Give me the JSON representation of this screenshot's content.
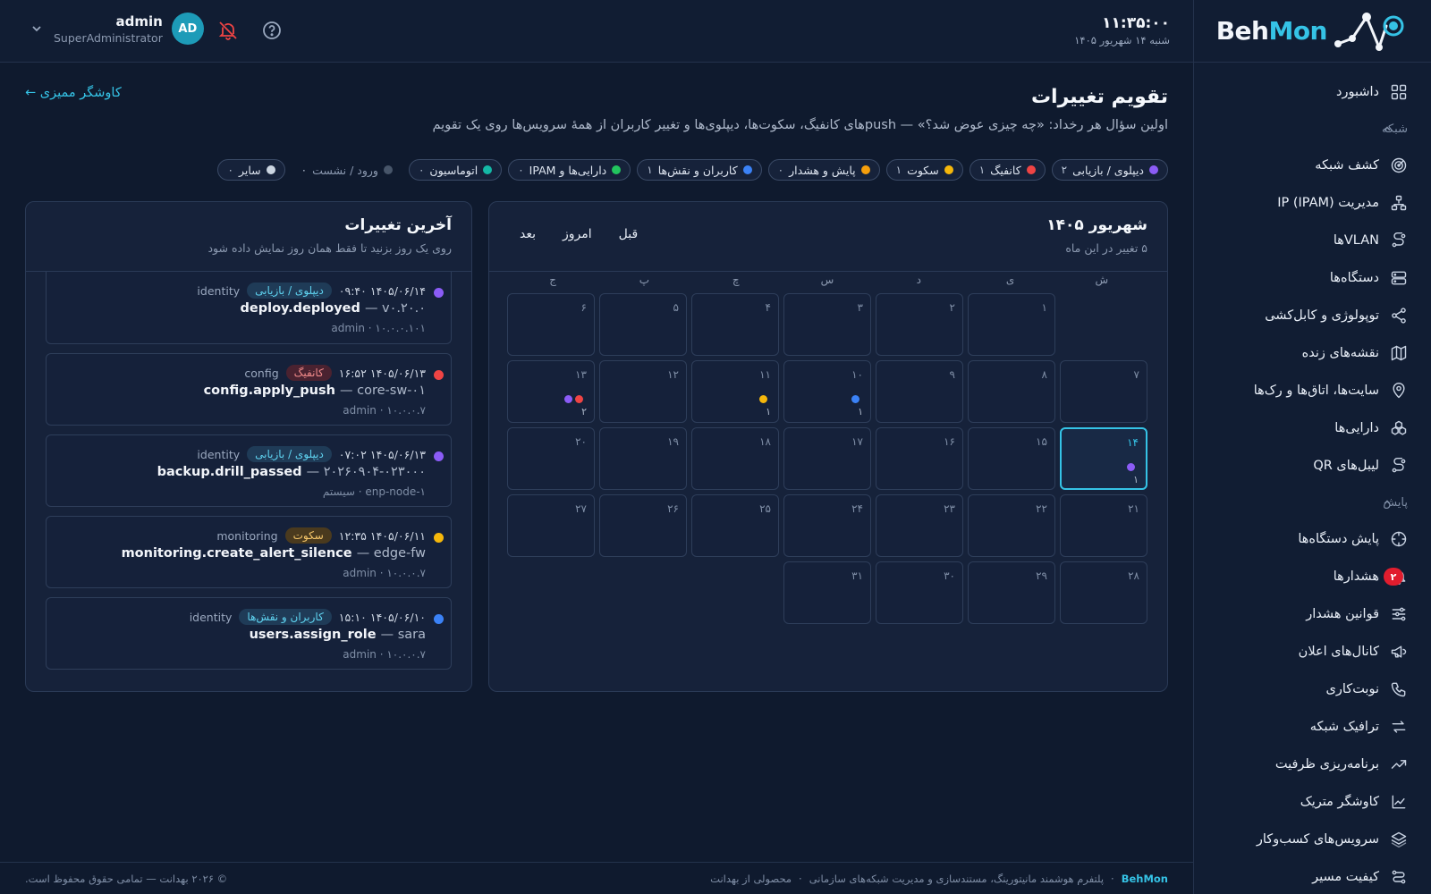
{
  "logo": {
    "part1": "Beh",
    "part2": "Mon"
  },
  "topbar": {
    "time": "۱۱:۳۵:۰۰",
    "date": "شنبه ۱۴ شهریور ۱۴۰۵",
    "user_name": "admin",
    "user_role": "SuperAdministrator",
    "avatar_initials": "AD"
  },
  "sidebar": {
    "items": [
      {
        "label": "داشبورد",
        "icon": "dashboard-icon"
      },
      {
        "section": "شبکه"
      },
      {
        "label": "کشف شبکه",
        "icon": "radar-icon"
      },
      {
        "label": "مدیریت IP (IPAM)",
        "icon": "network-icon"
      },
      {
        "label": "VLANها",
        "icon": "route-icon"
      },
      {
        "label": "دستگاه‌ها",
        "icon": "server-icon"
      },
      {
        "label": "توپولوژی و کابل‌کشی",
        "icon": "share-icon"
      },
      {
        "label": "نقشه‌های زنده",
        "icon": "map-icon"
      },
      {
        "label": "سایت‌ها، اتاق‌ها و رک‌ها",
        "icon": "location-icon"
      },
      {
        "label": "دارایی‌ها",
        "icon": "boxes-icon"
      },
      {
        "label": "لیبل‌های QR",
        "icon": "route-icon"
      },
      {
        "section": "پایش"
      },
      {
        "label": "پایش دستگاه‌ها",
        "icon": "crosshair-icon"
      },
      {
        "label": "هشدارها",
        "icon": "bell-icon",
        "badge": "۲"
      },
      {
        "label": "قوانین هشدار",
        "icon": "sliders-icon"
      },
      {
        "label": "کانال‌های اعلان",
        "icon": "megaphone-icon"
      },
      {
        "label": "نوبت‌کاری",
        "icon": "phone-icon"
      },
      {
        "label": "ترافیک شبکه",
        "icon": "arrows-icon"
      },
      {
        "label": "برنامه‌ریزی ظرفیت",
        "icon": "trend-icon"
      },
      {
        "label": "کاوشگر متریک",
        "icon": "chart-icon"
      },
      {
        "label": "سرویس‌های کسب‌وکار",
        "icon": "layers-icon"
      },
      {
        "label": "کیفیت مسیر",
        "icon": "path-icon"
      }
    ]
  },
  "page": {
    "title": "تقویم تغییرات",
    "subtitle": "اولین سؤال هر رخداد: «چه چیزی عوض شد؟» — pushهای کانفیگ، سکوت‌ها، دیپلوی‌ها و تغییر کاربران از همهٔ سرویس‌ها روی یک تقویم",
    "explorer_link": "کاوشگر ممیزی ←"
  },
  "filters": [
    {
      "label": "دیپلوی / بازیابی",
      "count": "۲",
      "color": "#8b5cf6",
      "plain": false
    },
    {
      "label": "کانفیگ",
      "count": "۱",
      "color": "#ef4444",
      "plain": false
    },
    {
      "label": "سکوت",
      "count": "۱",
      "color": "#f5b70b",
      "plain": false
    },
    {
      "label": "پایش و هشدار",
      "count": "۰",
      "color": "#f59e0b",
      "plain": false
    },
    {
      "label": "کاربران و نقش‌ها",
      "count": "۱",
      "color": "#3b82f6",
      "plain": false
    },
    {
      "label": "دارایی‌ها و IPAM",
      "count": "۰",
      "color": "#22c55e",
      "plain": false
    },
    {
      "label": "اتوماسیون",
      "count": "۰",
      "color": "#14b8a6",
      "plain": false
    },
    {
      "label": "ورود / نشست",
      "count": "۰",
      "color": "#475569",
      "plain": true
    },
    {
      "label": "سایر",
      "count": "۰",
      "color": "#cbd5e1",
      "plain": false
    }
  ],
  "calendar": {
    "title": "شهریور ۱۴۰۵",
    "count_text": "۵ تغییر در این ماه",
    "nav": {
      "prev": "قبل",
      "today": "امروز",
      "next": "بعد"
    },
    "weekdays": [
      "ش",
      "ی",
      "د",
      "س",
      "چ",
      "پ",
      "ج"
    ],
    "leading_empty": 1,
    "days": [
      {
        "n": "۱"
      },
      {
        "n": "۲"
      },
      {
        "n": "۳"
      },
      {
        "n": "۴"
      },
      {
        "n": "۵"
      },
      {
        "n": "۶"
      },
      {
        "n": "۷"
      },
      {
        "n": "۸"
      },
      {
        "n": "۹"
      },
      {
        "n": "۱۰",
        "dots": [
          "#3b82f6"
        ],
        "count": "۱"
      },
      {
        "n": "۱۱",
        "dots": [
          "#f5b70b"
        ],
        "count": "۱"
      },
      {
        "n": "۱۲"
      },
      {
        "n": "۱۳",
        "dots": [
          "#ef4444",
          "#8b5cf6"
        ],
        "count": "۲"
      },
      {
        "n": "۱۴",
        "dots": [
          "#8b5cf6"
        ],
        "count": "۱",
        "today": true
      },
      {
        "n": "۱۵"
      },
      {
        "n": "۱۶"
      },
      {
        "n": "۱۷"
      },
      {
        "n": "۱۸"
      },
      {
        "n": "۱۹"
      },
      {
        "n": "۲۰"
      },
      {
        "n": "۲۱"
      },
      {
        "n": "۲۲"
      },
      {
        "n": "۲۳"
      },
      {
        "n": "۲۴"
      },
      {
        "n": "۲۵"
      },
      {
        "n": "۲۶"
      },
      {
        "n": "۲۷"
      },
      {
        "n": "۲۸"
      },
      {
        "n": "۲۹"
      },
      {
        "n": "۳۰"
      },
      {
        "n": "۳۱"
      }
    ]
  },
  "recent": {
    "title": "آخرین تغییرات",
    "subtitle": "روی یک روز بزنید تا فقط همان روز نمایش داده شود",
    "events": [
      {
        "dot": "#8b5cf6",
        "time": "۱۴۰۵/۰۶/۱۴ ۰۹:۴۰",
        "tag": "دیپلوی / بازیابی",
        "tag_bg": "#1f3b57",
        "tag_fg": "#5fd3f0",
        "category": "identity",
        "action": "deploy.deployed",
        "target": "v۰.۲۰.۰",
        "meta": "admin · ۱۰.۰.۰.۱۰۱"
      },
      {
        "dot": "#ef4444",
        "time": "۱۴۰۵/۰۶/۱۳ ۱۶:۵۲",
        "tag": "کانفیگ",
        "tag_bg": "#4a2230",
        "tag_fg": "#f08a8a",
        "category": "config",
        "action": "config.apply_push",
        "target": "core-sw-۰۱",
        "meta": "admin · ۱۰.۰.۰.۷"
      },
      {
        "dot": "#8b5cf6",
        "time": "۱۴۰۵/۰۶/۱۳ ۰۷:۰۲",
        "tag": "دیپلوی / بازیابی",
        "tag_bg": "#1f3b57",
        "tag_fg": "#5fd3f0",
        "category": "identity",
        "action": "backup.drill_passed",
        "target": "۲۰۲۶۰۹۰۴-۰۲۳۰۰۰",
        "meta": "سیستم · enp-node-۱"
      },
      {
        "dot": "#f5b70b",
        "time": "۱۴۰۵/۰۶/۱۱ ۱۲:۳۵",
        "tag": "سکوت",
        "tag_bg": "#4a3a1e",
        "tag_fg": "#f5c66a",
        "category": "monitoring",
        "action": "monitoring.create_alert_silence",
        "target": "edge-fw",
        "meta": "admin · ۱۰.۰.۰.۷"
      },
      {
        "dot": "#3b82f6",
        "time": "۱۴۰۵/۰۶/۱۰ ۱۵:۱۰",
        "tag": "کاربران و نقش‌ها",
        "tag_bg": "#1f3b57",
        "tag_fg": "#5fd3f0",
        "category": "identity",
        "action": "users.assign_role",
        "target": "sara",
        "meta": "admin · ۱۰.۰.۰.۷"
      }
    ]
  },
  "footer": {
    "brand": "BehMon",
    "tagline": "پلتفرم هوشمند مانیتورینگ، مستندسازی و مدیریت شبکه‌های سازمانی",
    "product_of": "محصولی از بهدانت",
    "copyright": "© ۲۰۲۶ بهدانت — تمامی حقوق محفوظ است."
  }
}
